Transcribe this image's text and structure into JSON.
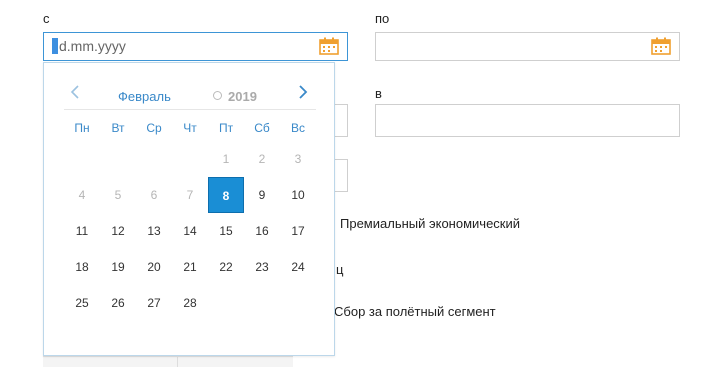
{
  "labels": {
    "from": "с",
    "to": "по",
    "in": "в",
    "partial_c": "ц"
  },
  "fields": {
    "from_placeholder": "d.mm.yyyy",
    "from_first_char": "d"
  },
  "background_text": {
    "premium": "Премиальный экономический",
    "segment_fee": "Сбор за полётный сегмент"
  },
  "picker": {
    "month": "Февраль",
    "year": "2019",
    "weekdays": [
      "Пн",
      "Вт",
      "Ср",
      "Чт",
      "Пт",
      "Сб",
      "Вс"
    ],
    "weeks": [
      [
        "",
        "",
        "",
        "",
        "1",
        "2",
        "3"
      ],
      [
        "4",
        "5",
        "6",
        "7",
        "8",
        "9",
        "10"
      ],
      [
        "11",
        "12",
        "13",
        "14",
        "15",
        "16",
        "17"
      ],
      [
        "18",
        "19",
        "20",
        "21",
        "22",
        "23",
        "24"
      ],
      [
        "25",
        "26",
        "27",
        "28",
        "",
        "",
        ""
      ]
    ],
    "selected": "8",
    "disabled": [
      "1",
      "2",
      "3",
      "4",
      "5",
      "6",
      "7"
    ]
  },
  "colors": {
    "accent": "#1a8ed5",
    "calendar_icon": "#f0a030",
    "header_text": "#3a89c9"
  },
  "icons": {
    "prev": "chevron-left-icon",
    "next": "chevron-right-icon",
    "calendar": "calendar-icon"
  }
}
